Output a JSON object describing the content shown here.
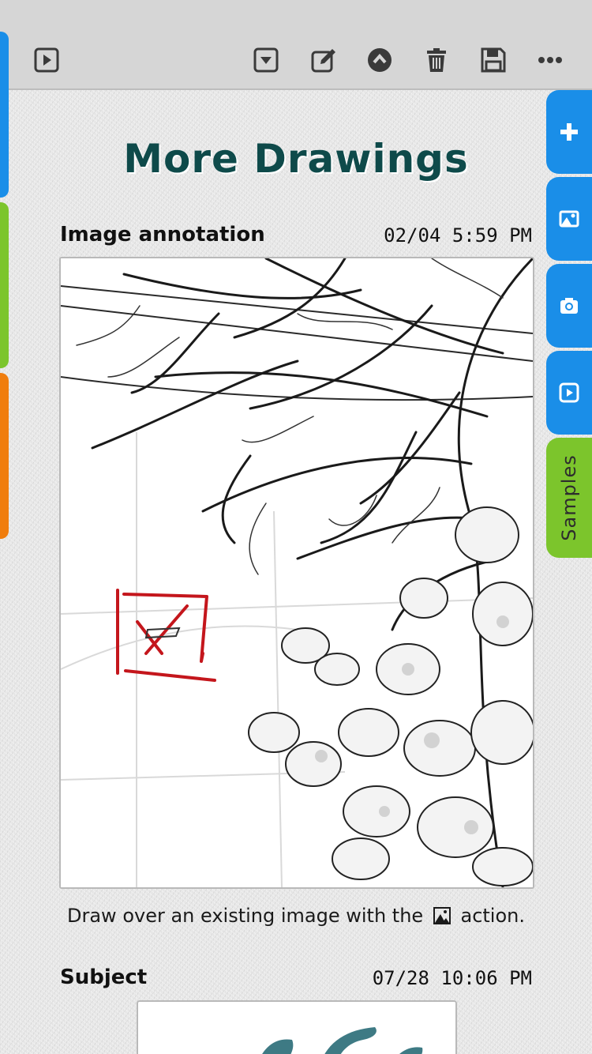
{
  "colors": {
    "accent_blue": "#1a8ee8",
    "accent_green": "#7cc52c",
    "accent_orange": "#f07d0d",
    "title_color": "#0e4a4a",
    "annotation_red": "#c4161c"
  },
  "toolbar": {
    "play_icon": "play-icon",
    "move_down_icon": "move-down-icon",
    "edit_icon": "edit-icon",
    "move_up_icon": "move-up-icon",
    "delete_icon": "trash-icon",
    "save_icon": "save-icon",
    "more_icon": "more-icon"
  },
  "side_tabs": {
    "items": [
      {
        "icon": "plus-icon"
      },
      {
        "icon": "image-icon"
      },
      {
        "icon": "camera-icon"
      },
      {
        "icon": "video-icon"
      }
    ],
    "samples_label": "Samples"
  },
  "page": {
    "title": "More Drawings"
  },
  "notes": [
    {
      "title": "Image annotation",
      "date": "02/04  5:59 PM",
      "caption_before": "Draw over an existing image with the",
      "caption_icon": "image-icon",
      "caption_after": "action."
    },
    {
      "title": "Subject",
      "date": "07/28 10:06 PM"
    }
  ]
}
